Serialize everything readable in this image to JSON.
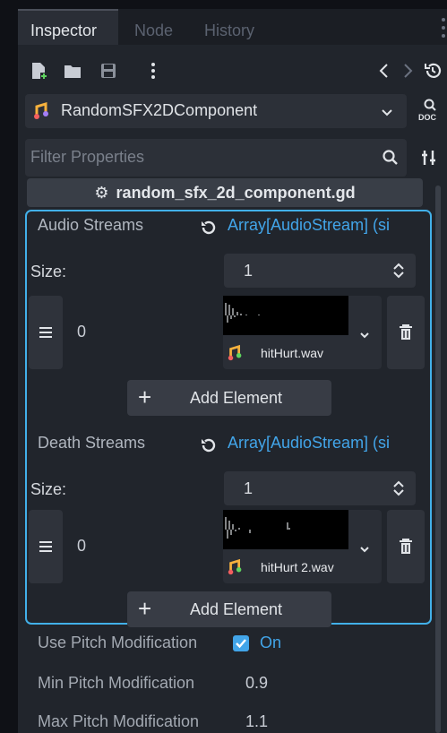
{
  "tabs": [
    {
      "label": "Inspector"
    },
    {
      "label": "Node"
    },
    {
      "label": "History"
    }
  ],
  "toolbar": {
    "icons": [
      "new-resource-icon",
      "open-folder-icon",
      "save-icon",
      "more-icon",
      "back-icon",
      "forward-icon",
      "history-icon"
    ]
  },
  "resource": {
    "name": "RandomSFX2DComponent",
    "doc_label": "DOC"
  },
  "filter": {
    "placeholder": "Filter Properties"
  },
  "script": {
    "label": "random_sfx_2d_component.gd"
  },
  "groups": [
    {
      "label": "Audio Streams",
      "value": "Array[AudioStream] (si",
      "size_label": "Size:",
      "size_value": "1",
      "element": {
        "index": "0",
        "file": "hitHurt.wav"
      },
      "add_label": "Add Element"
    },
    {
      "label": "Death Streams",
      "value": "Array[AudioStream] (si",
      "size_label": "Size:",
      "size_value": "1",
      "element": {
        "index": "0",
        "file": "hitHurt 2.wav"
      },
      "add_label": "Add Element"
    }
  ],
  "props": {
    "pitch_mod_label": "Use Pitch Modification",
    "pitch_mod_value": "On",
    "min_label": "Min Pitch Modification",
    "min_value": "0.9",
    "max_label": "Max Pitch Modification",
    "max_value": "1.1"
  },
  "colors": {
    "accent": "#42b0e9",
    "panel": "#21252c",
    "field": "#2c3038"
  }
}
